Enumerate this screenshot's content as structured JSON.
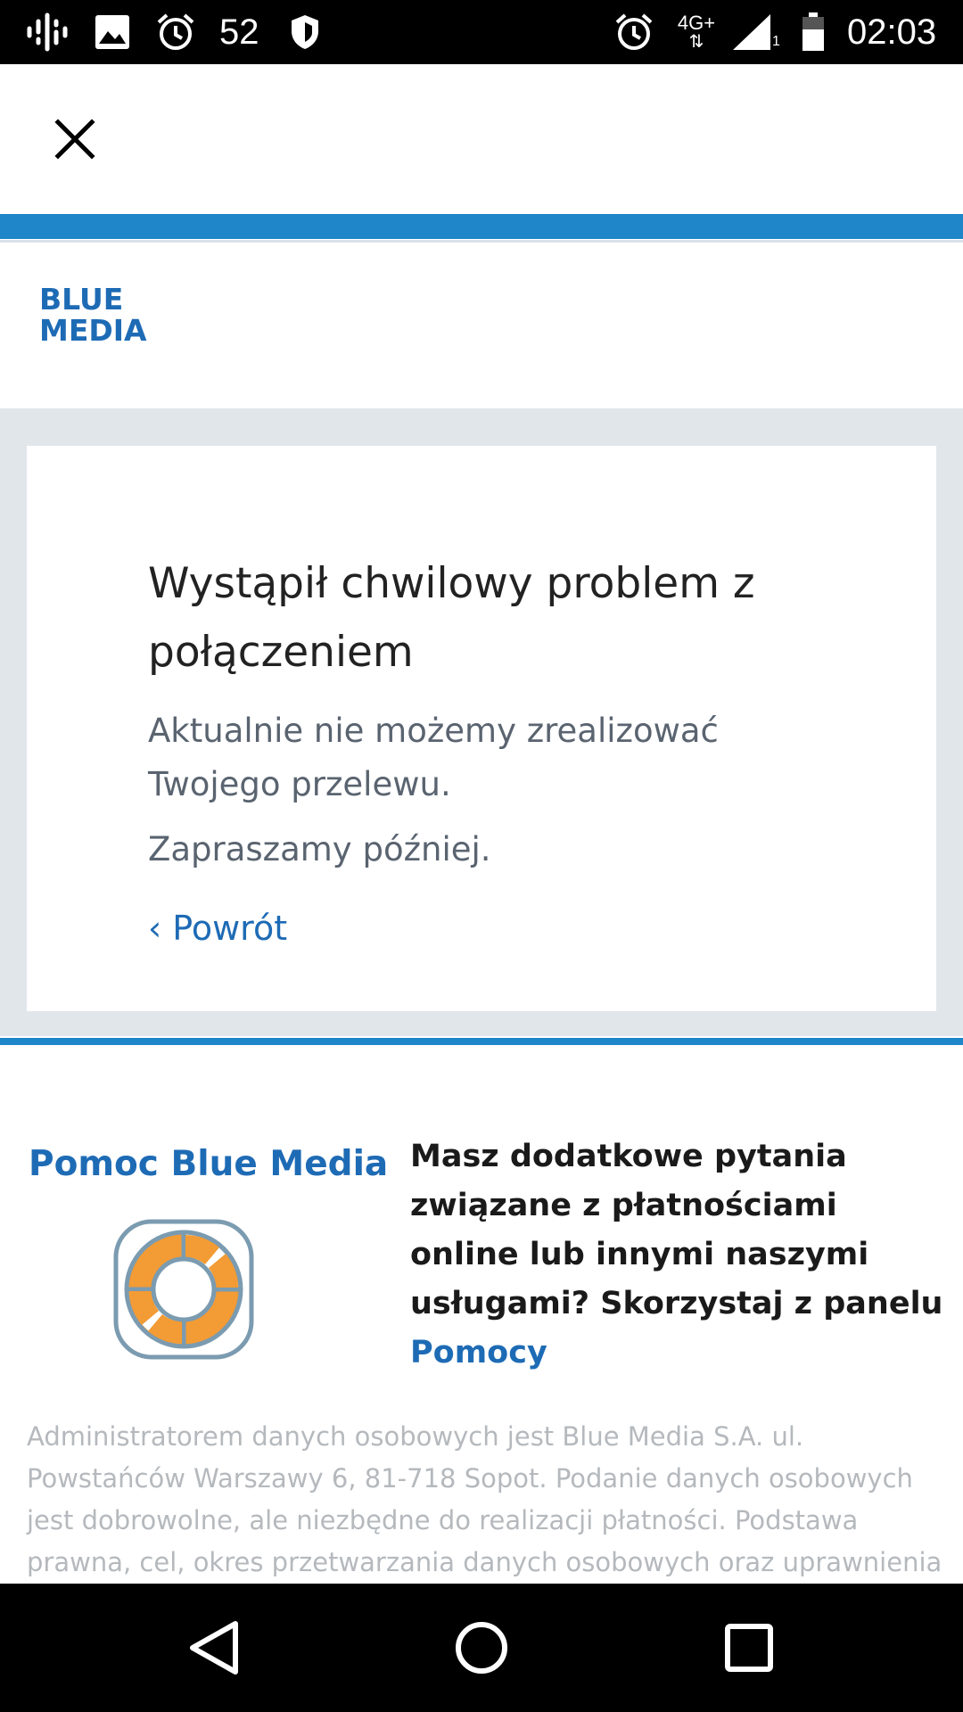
{
  "status_bar": {
    "notification_count": "52",
    "network": "4G+",
    "sim_slot": "1",
    "time": "02:03",
    "left_icons": [
      "podcast-icon",
      "gallery-icon",
      "alarm-icon",
      "shield-icon"
    ],
    "right_icons": [
      "alarm-icon",
      "network-4g-icon",
      "signal-icon",
      "battery-icon"
    ]
  },
  "top_bar": {
    "close_icon": "close-icon"
  },
  "brand": {
    "logo_line1": "BLUE",
    "logo_line2": "MEDIA",
    "accent_color": "#1e86c9",
    "brand_color": "#1e6bb5"
  },
  "error_card": {
    "title": "Wystąpił chwilowy problem z połączeniem",
    "message": "Aktualnie nie możemy zrealizować Twojego przelewu.",
    "invite": "Zapraszamy później.",
    "back_link": "‹ Powrót"
  },
  "help": {
    "title": "Pomoc Blue Media",
    "icon": "lifebuoy-icon",
    "text": "Masz dodatkowe pytania związane z płatnościami online lub innymi naszymi usługami? Skorzystaj z panelu",
    "link": "Pomocy"
  },
  "legal": {
    "text": "Administratorem danych osobowych jest Blue Media S.A. ul. Powstańców Warszawy 6, 81-718 Sopot. Podanie danych osobowych jest dobrowolne, ale niezbędne do realizacji płatności. Podstawa prawna, cel, okres przetwarzania danych osobowych oraz uprawnienia"
  },
  "nav_bar": {
    "buttons": [
      "back-icon",
      "home-icon",
      "recents-icon"
    ]
  }
}
